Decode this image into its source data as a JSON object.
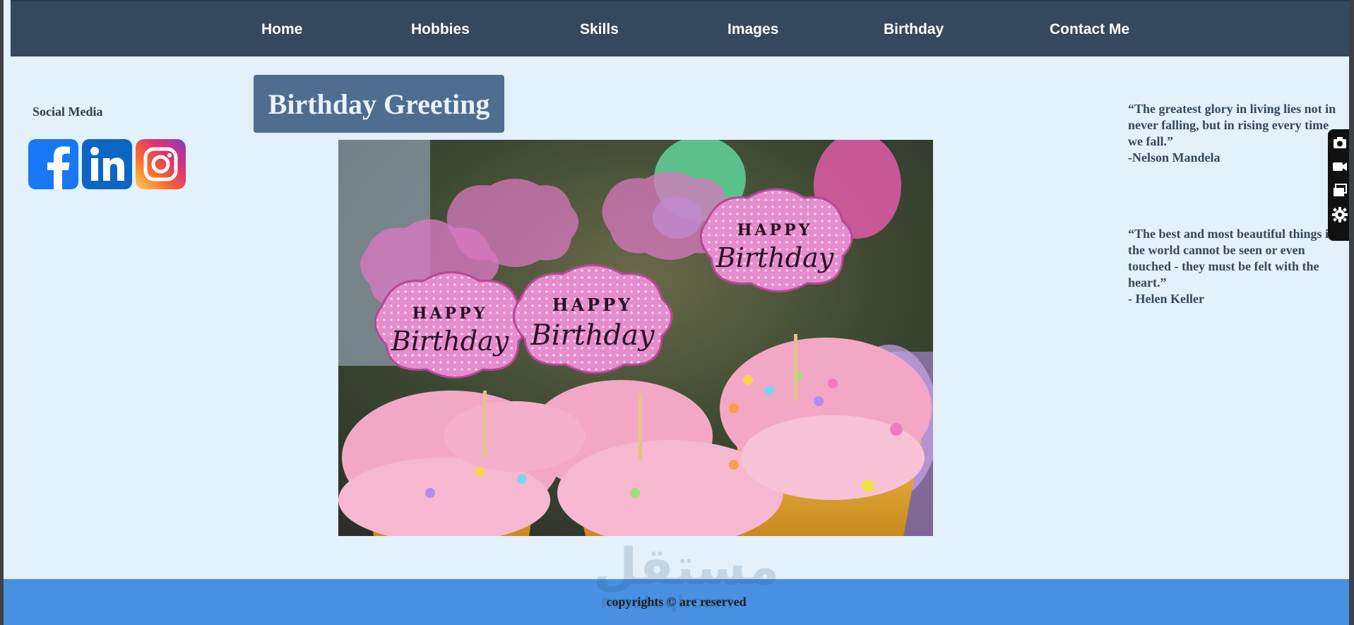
{
  "nav": {
    "items": [
      {
        "label": "Home"
      },
      {
        "label": "Hobbies"
      },
      {
        "label": "Skills"
      },
      {
        "label": "Images"
      },
      {
        "label": "Birthday"
      },
      {
        "label": "Contact Me"
      }
    ]
  },
  "sidebar": {
    "title": "Social Media",
    "icons": [
      "facebook-icon",
      "linkedin-icon",
      "instagram-icon"
    ]
  },
  "main": {
    "title": "Birthday Greeting",
    "image": {
      "topper_line1": "HAPPY",
      "topper_line2": "Birthday"
    }
  },
  "quotes": [
    {
      "text": "“The greatest glory in living lies not in never falling, but in rising every time we fall.”",
      "author": "-Nelson Mandela"
    },
    {
      "text": "“The best and most beautiful things in the world cannot be seen or even touched - they must be felt with the heart.”",
      "author": "- Helen Keller"
    }
  ],
  "footer": {
    "text": "copyrights © are reserved"
  },
  "watermark": {
    "arabic": "مستقل",
    "latin": "mostaql.com"
  },
  "toolbar": {
    "icons": [
      "screenshot-icon",
      "video-icon",
      "windows-icon",
      "settings-icon"
    ]
  },
  "colors": {
    "nav_bg": "#34495e",
    "page_bg": "#e3f1fd",
    "title_bg": "#4f6d8e",
    "footer_bg": "#4a90e2"
  }
}
